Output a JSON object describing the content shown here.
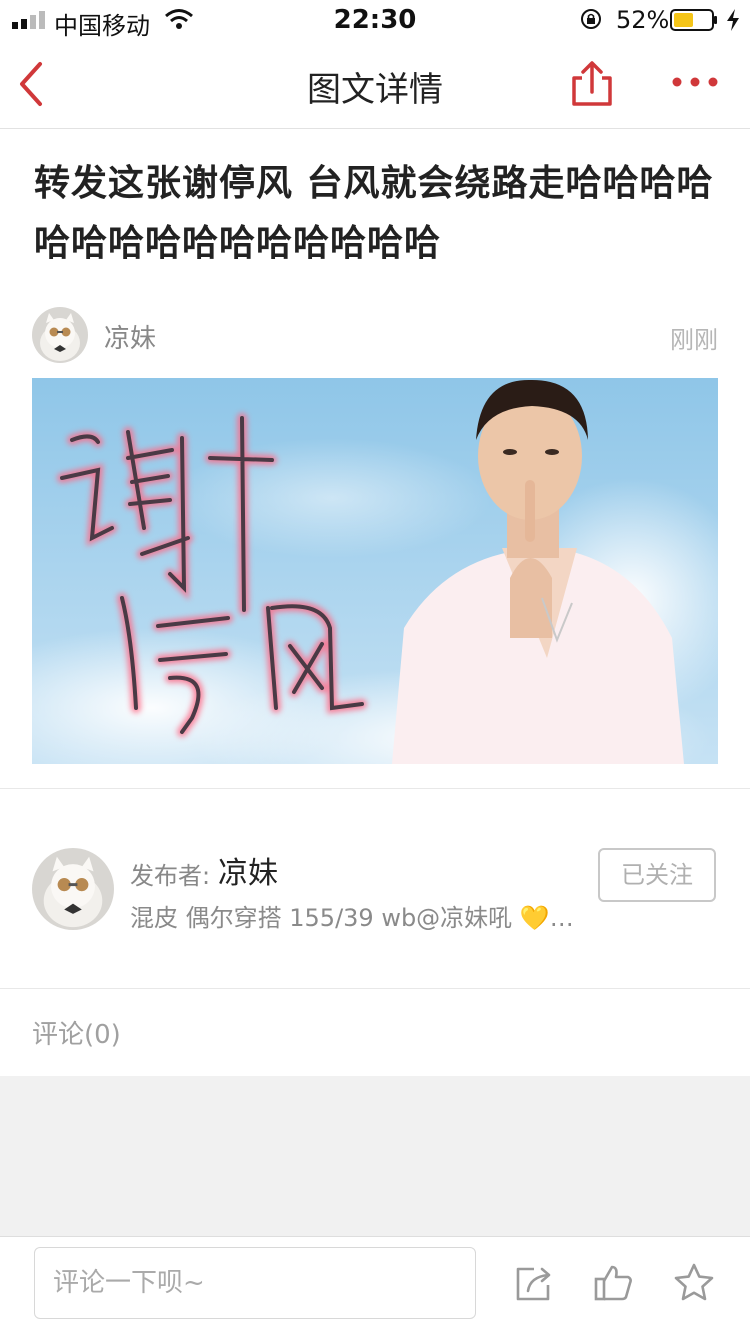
{
  "status_bar": {
    "carrier": "中国移动",
    "time": "22:30",
    "battery_percent": "52%",
    "battery_level": 0.52
  },
  "nav": {
    "title": "图文详情"
  },
  "article": {
    "title": "转发这张谢停风 台风就会绕路走哈哈哈哈哈哈哈哈哈哈哈哈哈哈哈",
    "author": "凉妹",
    "posted_time": "刚刚",
    "image_text": "谢停风"
  },
  "publisher": {
    "label": "发布者:",
    "name": "凉妹",
    "bio": "混皮 偶尔穿搭 155/39 wb@凉妹吼 💛…",
    "follow_label": "已关注"
  },
  "comments": {
    "title": "评论(0)"
  },
  "bottom_bar": {
    "placeholder": "评论一下呗~"
  },
  "colors": {
    "accent": "#d0383a"
  }
}
